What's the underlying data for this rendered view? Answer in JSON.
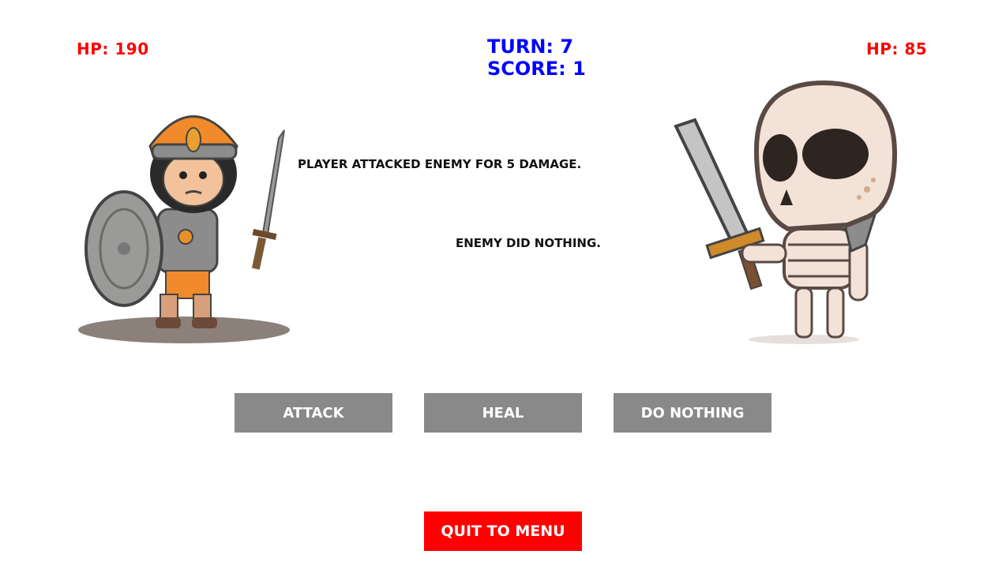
{
  "hud": {
    "player_hp": "HP: 190",
    "enemy_hp": "HP: 85",
    "turn": "TURN: 7",
    "score": "SCORE: 1"
  },
  "log": {
    "line_1": "PLAYER ATTACKED ENEMY FOR 5 DAMAGE.",
    "line_2": "ENEMY DID NOTHING."
  },
  "actions": {
    "attack": "ATTACK",
    "heal": "HEAL",
    "do_nothing": "DO NOTHING"
  },
  "quit_label": "QUIT TO MENU",
  "colors": {
    "hp": "#ff0000",
    "status": "#0000ff",
    "action_button": "#898989",
    "quit_button": "#ff0000"
  },
  "characters": {
    "player": "armored-warrior-with-shield-and-sword",
    "enemy": "skeleton-with-sword"
  }
}
